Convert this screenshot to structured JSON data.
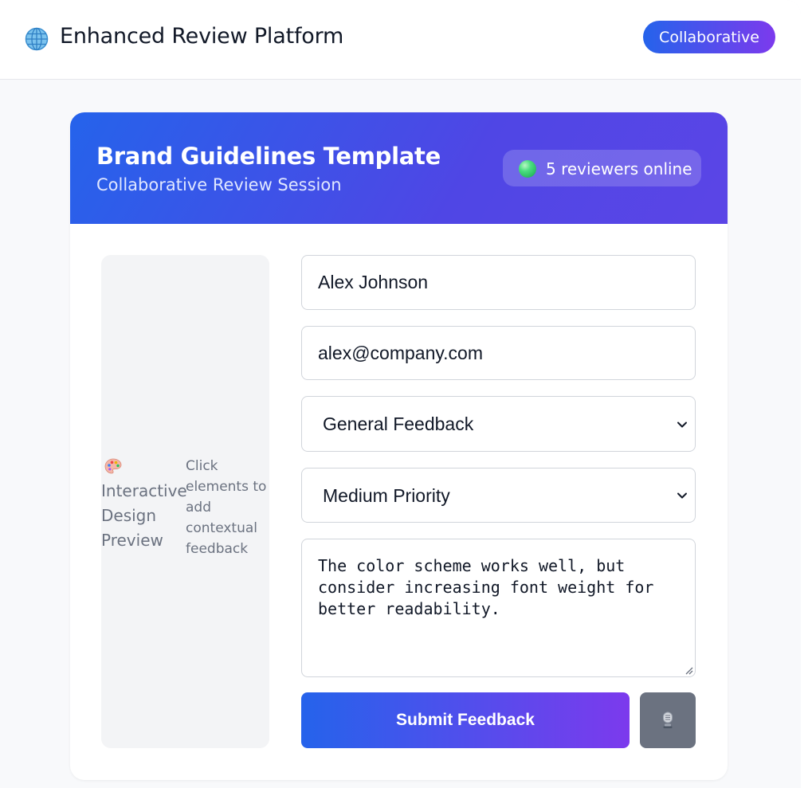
{
  "header": {
    "icon": "globe-icon",
    "title": "Enhanced Review Platform",
    "mode_badge": "Collaborative"
  },
  "card": {
    "title": "Brand Guidelines Template",
    "subtitle": "Collaborative Review Session",
    "online_status": "5 reviewers online",
    "status_color": "#22c55e"
  },
  "preview": {
    "icon": "palette-icon",
    "title": "Interactive Design Preview",
    "hint": "Click elements to add contextual feedback"
  },
  "form": {
    "name_value": "Alex Johnson",
    "email_value": "alex@company.com",
    "feedback_type": "General Feedback",
    "priority": "Medium Priority",
    "comment": "The color scheme works well, but consider increasing font weight for better readability.",
    "submit_label": "Submit Feedback",
    "voice_icon": "microphone-icon"
  },
  "colors": {
    "accent_start": "#2563eb",
    "accent_end": "#7c3aed",
    "voice_button": "#6b7280"
  }
}
